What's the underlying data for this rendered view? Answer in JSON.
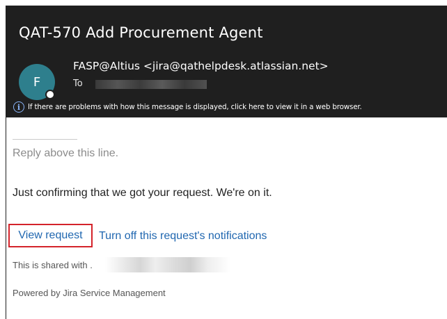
{
  "email": {
    "subject": "QAT-570 Add Procurement Agent",
    "avatar_initial": "F",
    "sender": "FASP@Altius <jira@qathelpdesk.atlassian.net>",
    "to_label": "To",
    "info_banner": "If there are problems with how this message is displayed, click here to view it in a web browser.",
    "info_icon": "info-icon"
  },
  "body": {
    "reply_above": "Reply above this line.",
    "confirmation": "Just confirming that we got your request. We're on it.",
    "view_request": "View request",
    "turn_off_notifications": "Turn off this request's notifications",
    "shared_with": "This is shared with .",
    "powered_by": "Powered by Jira Service Management"
  },
  "colors": {
    "header_bg": "#1f1f1f",
    "avatar_bg": "#2e7f8d",
    "link": "#2067b0",
    "highlight_box": "#d4232a"
  }
}
